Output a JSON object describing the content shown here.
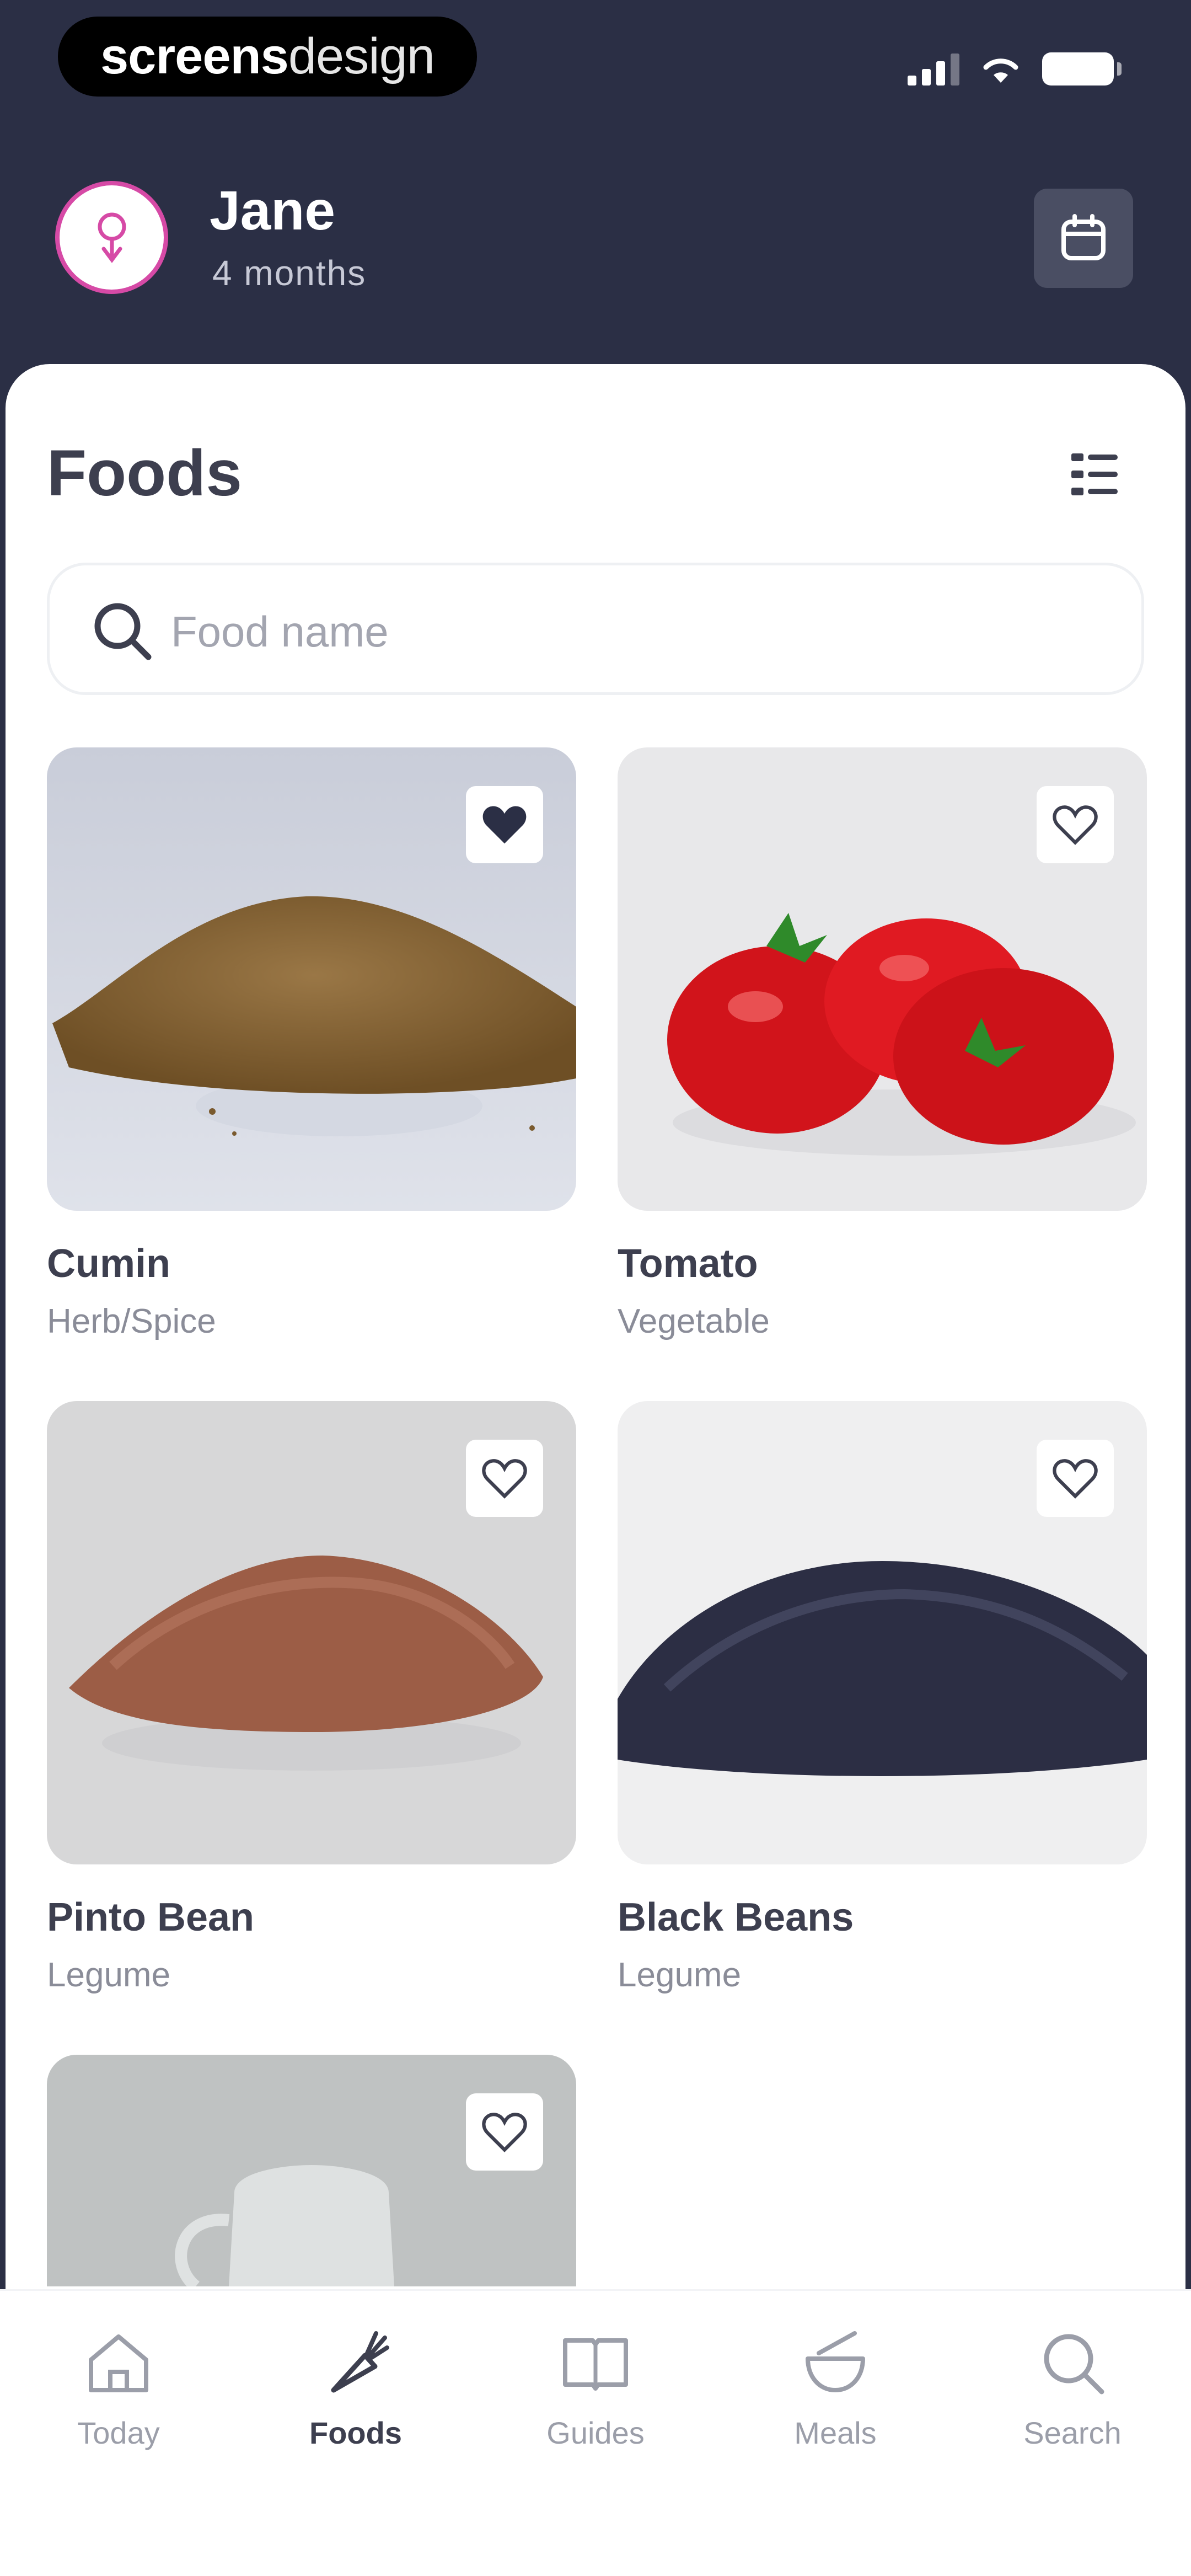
{
  "status_bar": {
    "brand_bold": "screens",
    "brand_light": "design"
  },
  "header": {
    "user_name": "Jane",
    "user_age": "4 months"
  },
  "page": {
    "title": "Foods"
  },
  "search": {
    "placeholder": "Food name"
  },
  "foods": [
    {
      "name": "Cumin",
      "category": "Herb/Spice",
      "favorite": true
    },
    {
      "name": "Tomato",
      "category": "Vegetable",
      "favorite": false
    },
    {
      "name": "Pinto Bean",
      "category": "Legume",
      "favorite": false
    },
    {
      "name": "Black Beans",
      "category": "Legume",
      "favorite": false
    },
    {
      "name": "",
      "category": "",
      "favorite": false
    }
  ],
  "tabs": [
    {
      "label": "Today",
      "icon": "home-icon",
      "active": false
    },
    {
      "label": "Foods",
      "icon": "carrot-icon",
      "active": true
    },
    {
      "label": "Guides",
      "icon": "book-icon",
      "active": false
    },
    {
      "label": "Meals",
      "icon": "bowl-icon",
      "active": false
    },
    {
      "label": "Search",
      "icon": "search-icon",
      "active": false
    }
  ],
  "colors": {
    "header_bg": "#2b2f45",
    "accent_pink": "#d64aa6",
    "text_dark": "#3d3f4f",
    "text_muted": "#8a8c98"
  }
}
